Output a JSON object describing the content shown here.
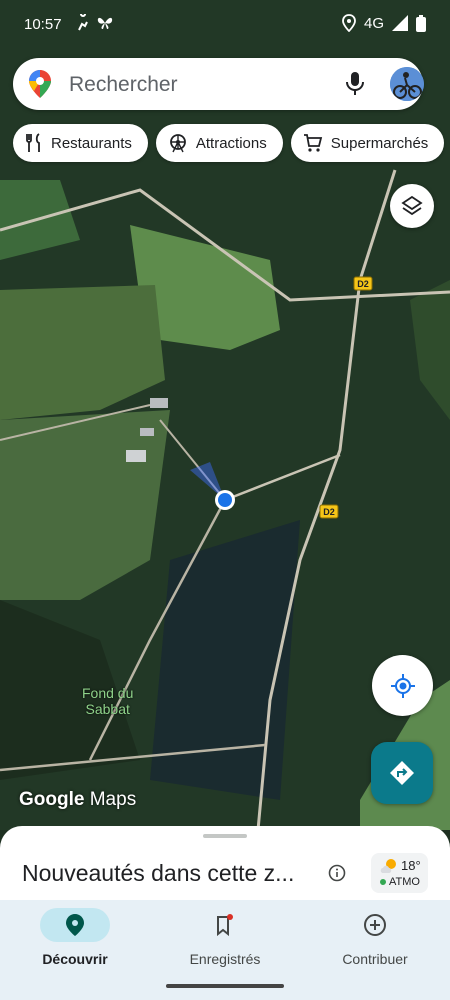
{
  "status_bar": {
    "time": "10:57",
    "network": "4G"
  },
  "search": {
    "placeholder": "Rechercher"
  },
  "chips": [
    {
      "label": "Restaurants",
      "icon": "fork-knife-icon"
    },
    {
      "label": "Attractions",
      "icon": "ferris-wheel-icon"
    },
    {
      "label": "Supermarchés",
      "icon": "cart-icon"
    }
  ],
  "map": {
    "road_labels": [
      "D2",
      "D2"
    ],
    "place_label": "Fond du\nSabbat",
    "place_label_line1": "Fond du",
    "place_label_line2": "Sabbat",
    "location_color": "#1a73e8"
  },
  "branding": {
    "google": "Google",
    "maps": "Maps"
  },
  "bottom_sheet": {
    "title": "Nouveautés dans cette z...",
    "weather_temp": "18°",
    "weather_label": "ATMO"
  },
  "nav": {
    "items": [
      {
        "label": "Découvrir",
        "icon": "explore-pin-icon",
        "active": true
      },
      {
        "label": "Enregistrés",
        "icon": "bookmark-icon",
        "active": false
      },
      {
        "label": "Contribuer",
        "icon": "plus-circle-icon",
        "active": false
      }
    ]
  },
  "colors": {
    "accent": "#1a73e8",
    "directions": "#0b7a8b",
    "nav_bg": "#e7f0f6"
  }
}
